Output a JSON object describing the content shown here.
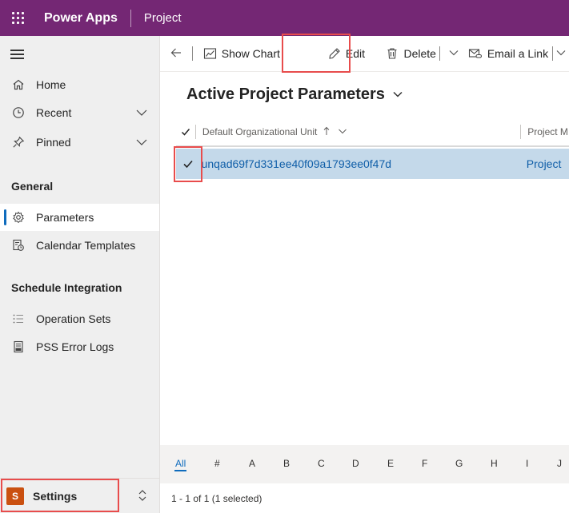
{
  "topbar": {
    "app_name": "Power Apps",
    "app_sub": "Project"
  },
  "sidenav": {
    "home": "Home",
    "recent": "Recent",
    "pinned": "Pinned",
    "group_general": "General",
    "parameters": "Parameters",
    "calendar_templates": "Calendar Templates",
    "group_schedule": "Schedule Integration",
    "operation_sets": "Operation Sets",
    "pss_error_logs": "PSS Error Logs",
    "area_initial": "S",
    "area_label": "Settings"
  },
  "commandbar": {
    "show_chart": "Show Chart",
    "edit": "Edit",
    "delete": "Delete",
    "email_link": "Email a Link"
  },
  "view": {
    "title": "Active Project Parameters",
    "columns": [
      "Default Organizational Unit",
      "Project M"
    ],
    "rows": [
      {
        "org_unit": "unqad69f7d331ee40f09a1793ee0f47d",
        "col2": "Project"
      }
    ]
  },
  "jumpbar": {
    "letters": [
      "All",
      "#",
      "A",
      "B",
      "C",
      "D",
      "E",
      "F",
      "G",
      "H",
      "I",
      "J"
    ]
  },
  "footer": {
    "status": "1 - 1 of 1 (1 selected)"
  },
  "colors": {
    "header_purple": "#742774",
    "selected_row": "#c4d9ea",
    "accent_blue": "#0f6cbd",
    "highlight_red": "#e84c4c",
    "avatar_orange": "#ca5010"
  }
}
